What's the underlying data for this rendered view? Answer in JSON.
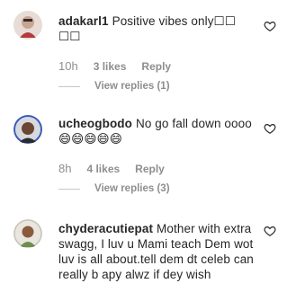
{
  "comments": [
    {
      "username": "adakarl1",
      "text": "Positive vibes only☐☐ ☐☐",
      "time": "10h",
      "likes": "3 likes",
      "reply_label": "Reply",
      "view_replies": "View replies (1)"
    },
    {
      "username": "ucheogbodo",
      "text": "No go fall down oooo 😄😄😄😄😄",
      "time": "8h",
      "likes": "4 likes",
      "reply_label": "Reply",
      "view_replies": "View replies (3)"
    },
    {
      "username": "chyderacutiepat",
      "text": "Mother with extra swagg, I luv u Mami teach Dem wot luv is all about.tell dem dt celeb can really b apy alwz if dey wish"
    }
  ]
}
